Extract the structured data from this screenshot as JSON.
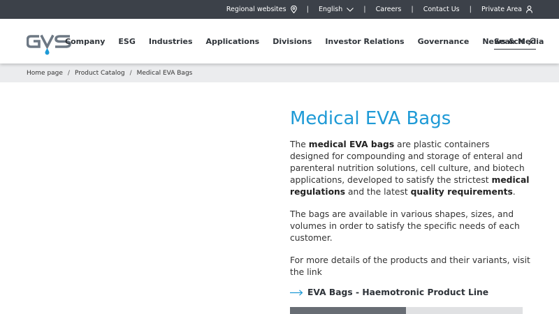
{
  "topbar": {
    "regional_label": "Regional websites",
    "regional_icon": "map-pin-icon",
    "language_label": "English",
    "language_icon": "chevron-down-icon",
    "careers_label": "Careers",
    "contact_label": "Contact Us",
    "private_label": "Private Area",
    "private_icon": "user-icon",
    "separator": "|"
  },
  "header": {
    "logo_alt": "GVS",
    "nav": [
      "Company",
      "ESG",
      "Industries",
      "Applications",
      "Divisions",
      "Investor Relations",
      "Governance",
      "News & Media"
    ],
    "search_label": "Search",
    "search_icon": "search-icon"
  },
  "breadcrumb": {
    "items": [
      "Home page",
      "Product Catalog",
      "Medical EVA Bags"
    ],
    "separator": "/"
  },
  "main": {
    "title": "Medical EVA Bags",
    "p1": {
      "t1": "The ",
      "b1": "medical EVA bags",
      "t2": " are plastic containers designed for compounding and storage of enteral and parenteral nutrition solutions, cell culture, and biotech applications, developed to satisfy the strictest ",
      "b2": "medical regulations",
      "t3": " and the latest ",
      "b3": "quality requirements",
      "t4": "."
    },
    "p2": "The bags are available in various shapes, sizes, and volumes in order to satisfy the specific needs of each customer.",
    "p3": "For more details of the products and their variants, visit the link",
    "link_label": "EVA Bags - Haemotronic Product Line",
    "link_icon": "arrow-right-icon"
  },
  "colors": {
    "topbar_bg": "#3c4149",
    "title_blue": "#1e9ad6",
    "breadcrumb_bg": "#ebecee",
    "logo_gray": "#6d7884",
    "logo_blue": "#1e9ad6"
  }
}
